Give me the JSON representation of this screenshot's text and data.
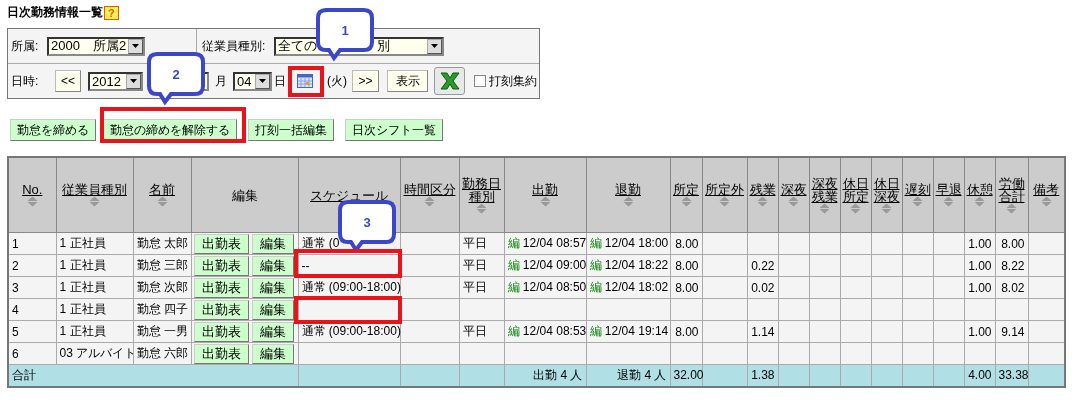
{
  "title": "日次勤務情報一覧",
  "help_badge": "?",
  "filters": {
    "affiliation": {
      "label": "所属:",
      "value": "2000　所属2"
    },
    "employee_type": {
      "label": "従業員種別:",
      "value_parts": [
        "全ての",
        "別"
      ]
    },
    "date": {
      "label": "日時:",
      "prev": "<<",
      "year": "2012",
      "month_unit": "月",
      "day": "04",
      "day_unit": "日",
      "weekday": "(火)",
      "next": ">>",
      "show": "表示",
      "aggregate": {
        "label": "打刻集約",
        "checked": false
      }
    }
  },
  "actions": [
    "勤怠を締める",
    "勤怠の締めを解除する",
    "打刻一括編集",
    "日次シフト一覧"
  ],
  "table": {
    "columns": [
      {
        "label": "No.",
        "kind": "sort"
      },
      {
        "label": "従業員種別",
        "kind": "sort"
      },
      {
        "label": "名前",
        "kind": "sort"
      },
      {
        "label": "編集",
        "kind": "plain"
      },
      {
        "label": "スケジュール",
        "kind": "link"
      },
      {
        "label": "時間区分",
        "kind": "sort"
      },
      {
        "label": "勤務日種別",
        "kind": "sort"
      },
      {
        "label": "出勤",
        "kind": "sort"
      },
      {
        "label": "退勤",
        "kind": "sort"
      },
      {
        "label": "所定",
        "kind": "sort"
      },
      {
        "label": "所定外",
        "kind": "sort"
      },
      {
        "label": "残業",
        "kind": "sort"
      },
      {
        "label": "深夜",
        "kind": "sort"
      },
      {
        "label": "深夜残業",
        "kind": "sort"
      },
      {
        "label": "休日所定",
        "kind": "sort"
      },
      {
        "label": "休日深夜",
        "kind": "sort"
      },
      {
        "label": "遅刻",
        "kind": "sort"
      },
      {
        "label": "早退",
        "kind": "sort"
      },
      {
        "label": "休憩",
        "kind": "sort"
      },
      {
        "label": "労働合計",
        "kind": "sort"
      },
      {
        "label": "備考",
        "kind": "sort"
      }
    ],
    "rows": [
      {
        "no": "1",
        "type": "1 正社員",
        "name": "勤怠 太郎",
        "buttons": [
          "出勤表",
          "編集"
        ],
        "schedule": "通常 (0",
        "day_type": "平日",
        "clock_in": {
          "mark": "編",
          "time": "12/04 08:57"
        },
        "clock_out": {
          "mark": "編",
          "time": "12/04 18:00"
        },
        "scheduled": "8.00",
        "break": "1.00",
        "total_work": "8.00"
      },
      {
        "no": "2",
        "type": "1 正社員",
        "name": "勤怠 三郎",
        "buttons": [
          "出勤表",
          "編集"
        ],
        "schedule": "--",
        "day_type": "平日",
        "clock_in": {
          "mark": "編",
          "time": "12/04 09:00"
        },
        "clock_out": {
          "mark": "編",
          "time": "12/04 18:22"
        },
        "scheduled": "8.00",
        "overtime": "0.22",
        "break": "1.00",
        "total_work": "8.22"
      },
      {
        "no": "3",
        "type": "1 正社員",
        "name": "勤怠 次郎",
        "buttons": [
          "出勤表",
          "編集"
        ],
        "schedule": "通常 (09:00-18:00)",
        "day_type": "平日",
        "clock_in": {
          "mark": "編",
          "time": "12/04 08:50"
        },
        "clock_out": {
          "mark": "編",
          "time": "12/04 18:02"
        },
        "scheduled": "8.00",
        "overtime": "0.02",
        "break": "1.00",
        "total_work": "8.02"
      },
      {
        "no": "4",
        "type": "1 正社員",
        "name": "勤怠 四子",
        "buttons": [
          "出勤表",
          "編集"
        ]
      },
      {
        "no": "5",
        "type": "1 正社員",
        "name": "勤怠 一男",
        "buttons": [
          "出勤表",
          "編集"
        ],
        "schedule": "通常 (09:00-18:00)",
        "day_type": "平日",
        "clock_in": {
          "mark": "編",
          "time": "12/04 08:53"
        },
        "clock_out": {
          "mark": "編",
          "time": "12/04 19:14"
        },
        "scheduled": "8.00",
        "overtime": "1.14",
        "break": "1.00",
        "total_work": "9.14"
      },
      {
        "no": "6",
        "type": "03 アルバイト",
        "name": "勤怠 六郎",
        "buttons": [
          "出勤表",
          "編集"
        ]
      }
    ],
    "total": {
      "label": "合計",
      "clock_in": "出勤 4 人",
      "clock_out": "退勤 4 人",
      "scheduled": "32.00",
      "overtime": "1.38",
      "break": "4.00",
      "total_work": "33.38"
    }
  },
  "annotations": [
    {
      "kind": "callout",
      "label": "1"
    },
    {
      "kind": "callout",
      "label": "2"
    },
    {
      "kind": "callout",
      "label": "3"
    },
    {
      "kind": "highlight"
    },
    {
      "kind": "highlight"
    },
    {
      "kind": "highlight"
    },
    {
      "kind": "highlight"
    }
  ]
}
